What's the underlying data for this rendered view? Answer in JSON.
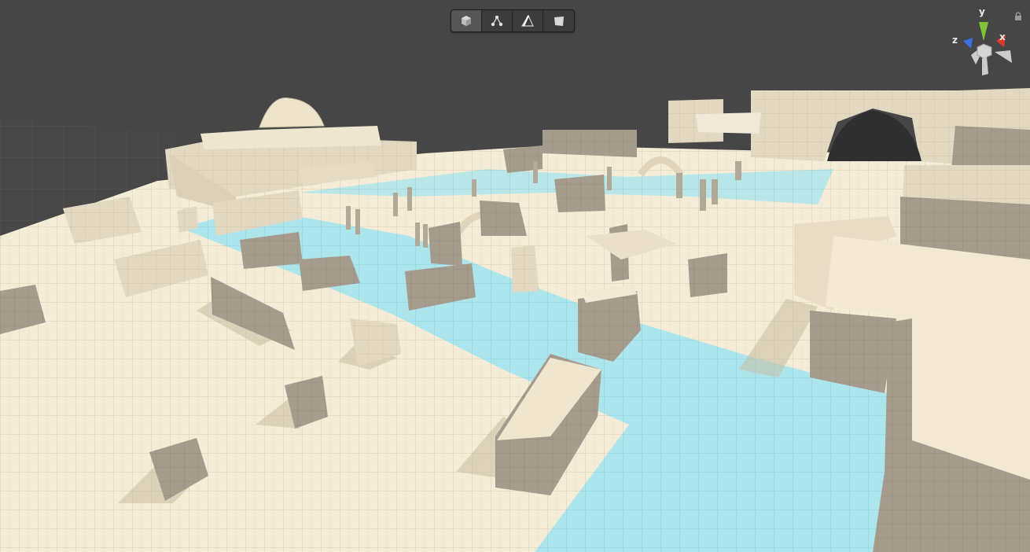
{
  "toolbar": {
    "tools": [
      {
        "name": "cube-tool",
        "icon": "cube-icon",
        "active": true
      },
      {
        "name": "vertex-tool",
        "icon": "vertex-icon",
        "active": false
      },
      {
        "name": "edge-tool",
        "icon": "edge-icon",
        "active": false
      },
      {
        "name": "face-tool",
        "icon": "face-icon",
        "active": false
      }
    ]
  },
  "gizmo": {
    "x_label": "x",
    "y_label": "y",
    "z_label": "z",
    "colors": {
      "x": "#e03a2e",
      "y": "#80c43a",
      "z": "#3a70e0",
      "neutral": "#cccccc"
    }
  },
  "scene": {
    "ground_color": "#f4ecd8",
    "block_color": "#e8ddc8",
    "water_color": "#a8e4ef",
    "sky_color": "#464646"
  }
}
